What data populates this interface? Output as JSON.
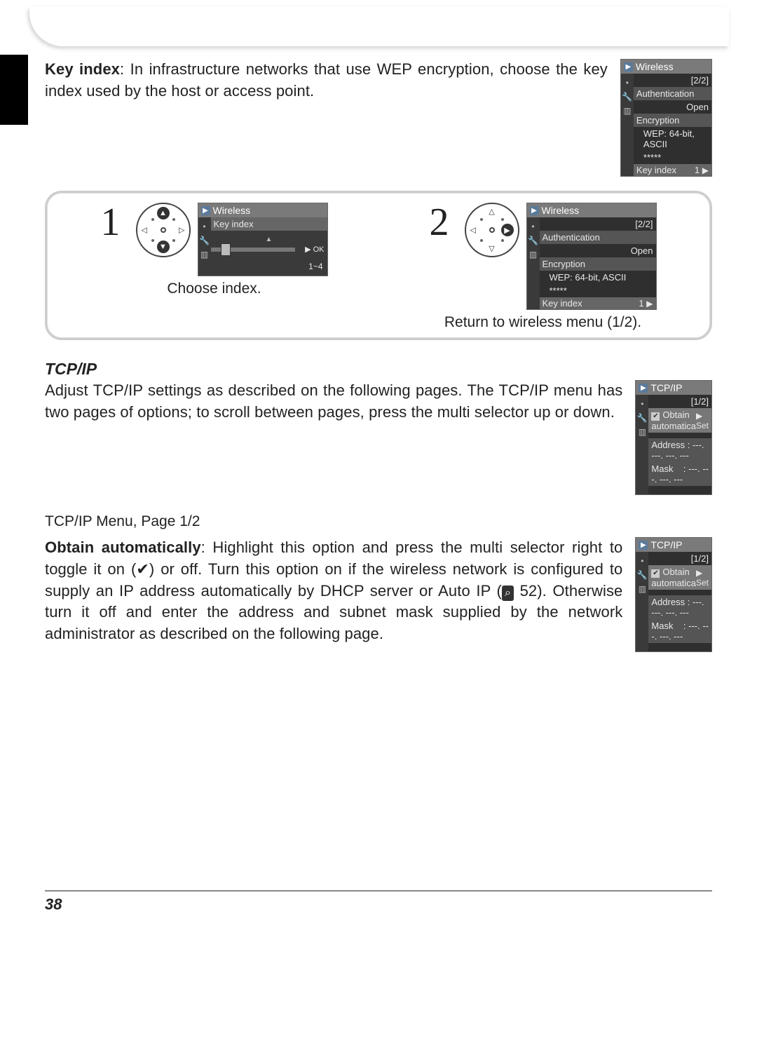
{
  "keyindex": {
    "label": "Key index",
    "text": ": In infrastructure networks that use WEP encryption, choose the key index used by the host or access point."
  },
  "lcd_wireless": {
    "title": "Wireless",
    "page": "[2/2]",
    "auth_label": "Authentication",
    "auth_value": "Open",
    "enc_label": "Encryption",
    "enc_value": "WEP: 64-bit, ASCII",
    "enc_mask": "*****",
    "keyindex_label": "Key index",
    "keyindex_value": "1"
  },
  "step1": {
    "num": "1",
    "lcd_title": "Wireless",
    "lcd_sub": "Key index",
    "ok": "▶ OK",
    "range": "1~4",
    "caption": "Choose index."
  },
  "step2": {
    "num": "2",
    "caption": "Return to wireless menu (1/2)."
  },
  "tcpip": {
    "heading": "TCP/IP",
    "text": "Adjust TCP/IP settings as described on the following pages. The TCP/IP menu has two pages of options; to scroll between pages, press the multi selector up or down.",
    "lcd_title": "TCP/IP",
    "lcd_page": "[1/2]",
    "obtain": "Obtain automatica",
    "set": "▶ Set",
    "address_label": "Address",
    "address_value": ": ---. ---. ---. ---",
    "mask_label": "Mask",
    "mask_value": ": ---. ---. ---. ---"
  },
  "menu12": {
    "heading": "TCP/IP Menu, Page 1/2"
  },
  "obtain": {
    "label": "Obtain automatically",
    "text1": ": Highlight this option and press the multi selector right to toggle it on (",
    "check": "✔",
    "text2": ") or off.  Turn this option on if the wireless network is configured to supply an IP address automatically by DHCP server or Auto IP (",
    "pgref": "52",
    "text3": ").  Otherwise turn it off and enter the address and subnet mask supplied by the network administrator as described on the following page."
  },
  "pagenum": "38"
}
